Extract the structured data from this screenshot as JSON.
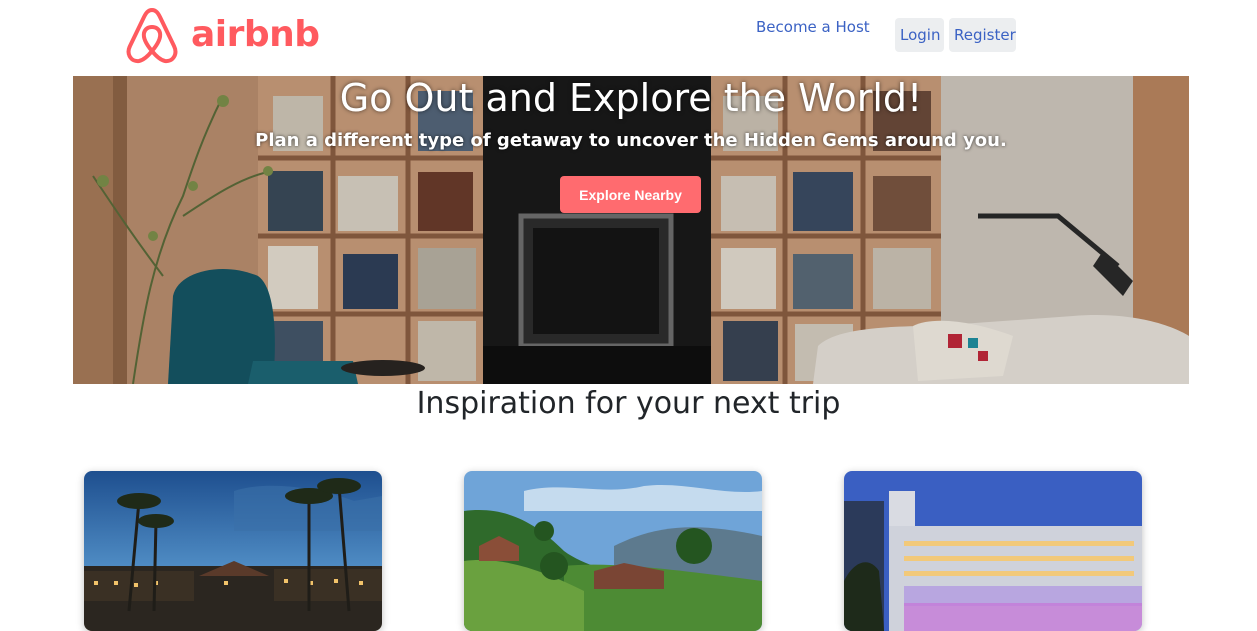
{
  "brand": {
    "name": "airbnb",
    "color": "#ff5a5f"
  },
  "nav": {
    "host_label": "Become a Host",
    "login_label": "Login",
    "register_label": "Register"
  },
  "hero": {
    "title": "Go Out and Explore the World!",
    "subtitle": "Plan a different type of getaway to uncover the Hidden Gems around you.",
    "cta_label": "Explore Nearby",
    "cta_color": "#ff6b6f"
  },
  "section": {
    "title": "Inspiration for your next trip"
  },
  "cards": [
    {
      "image": "tropical-resort-dusk-photo"
    },
    {
      "image": "green-hills-cottage-photo"
    },
    {
      "image": "modern-hotel-night-photo"
    }
  ]
}
